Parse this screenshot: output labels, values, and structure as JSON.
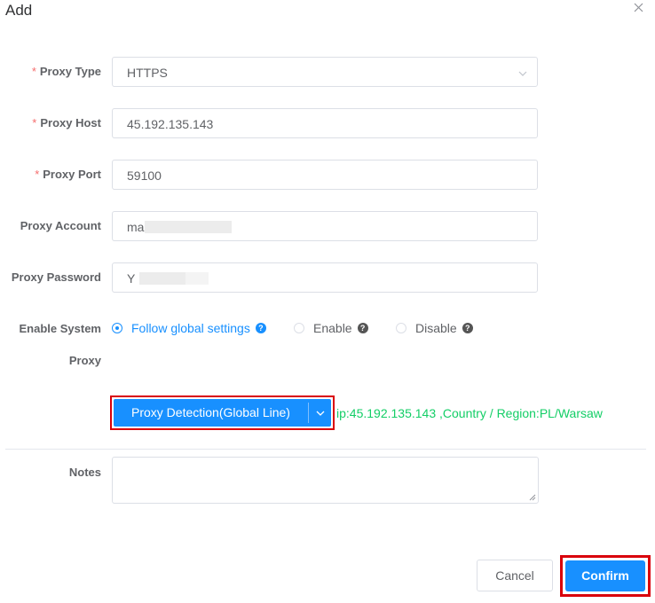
{
  "dialog": {
    "title": "Add"
  },
  "form": {
    "proxy_type": {
      "label": "Proxy Type",
      "required_mark": "*",
      "value": "HTTPS"
    },
    "proxy_host": {
      "label": "Proxy Host",
      "required_mark": "*",
      "value": "45.192.135.143"
    },
    "proxy_port": {
      "label": "Proxy Port",
      "required_mark": "*",
      "value": "59100"
    },
    "proxy_account": {
      "label": "Proxy Account",
      "value": "ma"
    },
    "proxy_password": {
      "label": "Proxy Password",
      "value": "Y"
    },
    "system_proxy": {
      "label_line1": "Enable System",
      "label_line2": "Proxy",
      "options": [
        {
          "label": "Follow global settings",
          "selected": true
        },
        {
          "label": "Enable",
          "selected": false
        },
        {
          "label": "Disable",
          "selected": false
        }
      ],
      "help_glyph": "?"
    },
    "detection": {
      "button_label": "Proxy Detection(Global Line)",
      "result_text": "ip:45.192.135.143 ,Country / Region:PL/Warsaw"
    },
    "notes": {
      "label": "Notes",
      "value": ""
    }
  },
  "footer": {
    "cancel_label": "Cancel",
    "confirm_label": "Confirm"
  },
  "colors": {
    "primary": "#1890ff",
    "required": "#f56c6c",
    "success": "#13ce66",
    "highlight": "#d9000b"
  },
  "icons": {
    "close": "close-icon",
    "select_arrow": "chevron-down-icon",
    "help": "question-circle-icon"
  }
}
